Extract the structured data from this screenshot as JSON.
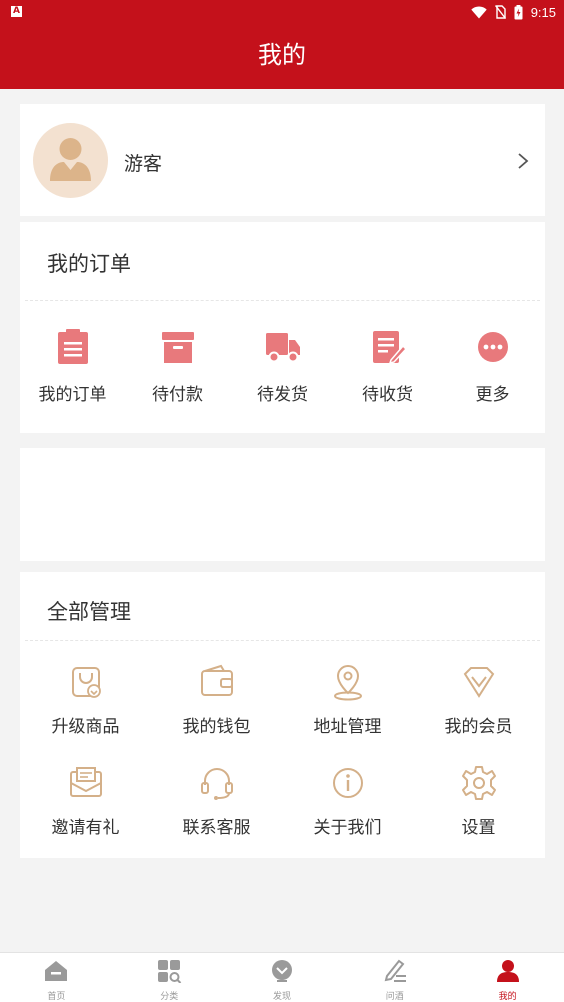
{
  "status_bar": {
    "time": "9:15",
    "app_icon_letter": "A"
  },
  "header": {
    "title": "我的"
  },
  "profile": {
    "name": "游客"
  },
  "orders": {
    "title": "我的订单",
    "items": [
      {
        "label": "我的订单",
        "icon": "clipboard-icon"
      },
      {
        "label": "待付款",
        "icon": "archive-box-icon"
      },
      {
        "label": "待发货",
        "icon": "truck-icon"
      },
      {
        "label": "待收货",
        "icon": "edit-document-icon"
      },
      {
        "label": "更多",
        "icon": "more-dots-icon"
      }
    ]
  },
  "manage": {
    "title": "全部管理",
    "items": [
      {
        "label": "升级商品",
        "icon": "upgrade-bag-icon"
      },
      {
        "label": "我的钱包",
        "icon": "wallet-icon"
      },
      {
        "label": "地址管理",
        "icon": "location-pin-icon"
      },
      {
        "label": "我的会员",
        "icon": "diamond-icon"
      },
      {
        "label": "邀请有礼",
        "icon": "envelope-icon"
      },
      {
        "label": "联系客服",
        "icon": "headset-icon"
      },
      {
        "label": "关于我们",
        "icon": "info-icon"
      },
      {
        "label": "设置",
        "icon": "gear-icon"
      }
    ]
  },
  "tabbar": {
    "items": [
      {
        "label": "首页",
        "icon": "home-icon"
      },
      {
        "label": "分类",
        "icon": "category-icon"
      },
      {
        "label": "发现",
        "icon": "discover-icon"
      },
      {
        "label": "问酒",
        "icon": "write-icon"
      },
      {
        "label": "我的",
        "icon": "user-icon"
      }
    ],
    "active_index": 4
  },
  "colors": {
    "brand_red": "#c4111b",
    "order_icon": "#e8797c",
    "manage_icon": "#d4b089",
    "muted": "#999999"
  }
}
